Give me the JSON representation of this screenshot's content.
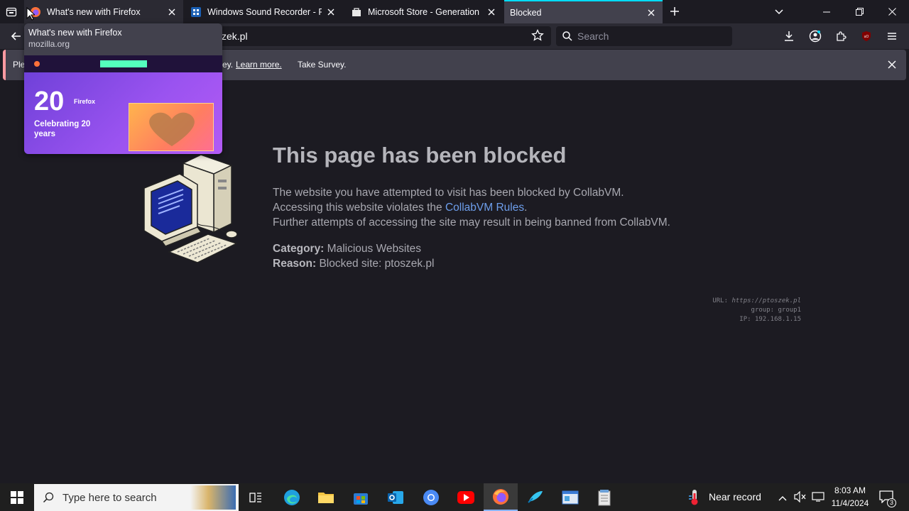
{
  "tabs": [
    {
      "title": "What's new with Firefox",
      "state": "hover"
    },
    {
      "title": "Windows Sound Recorder - Free",
      "state": "normal"
    },
    {
      "title": "Microsoft Store - Generation Pr",
      "state": "normal"
    },
    {
      "title": "Blocked",
      "state": "active"
    }
  ],
  "urlbar": {
    "url_partial": "zek.pl"
  },
  "searchbar": {
    "placeholder": "Search"
  },
  "notification": {
    "prefix": "Ple",
    "suffix": "ey.",
    "learn_more": "Learn more.",
    "take_survey": "Take Survey."
  },
  "tab_preview": {
    "title": "What's new with Firefox",
    "domain": "mozilla.org",
    "thumb_heading": "Celebrating 20 years",
    "thumb_brand": "Firefox",
    "thumb_big": "20"
  },
  "page": {
    "title": "This page has been blocked",
    "line1": "The website you have attempted to visit has been blocked by CollabVM.",
    "line2_pre": "Accessing this website violates the ",
    "line2_link": "CollabVM Rules",
    "line2_post": ".",
    "line3": "Further attempts of accessing the site may result in being banned from CollabVM.",
    "category_label": "Category:",
    "category_value": "Malicious Websites",
    "reason_label": "Reason:",
    "reason_value": "Blocked site: ptoszek.pl",
    "meta_url_label": "URL:",
    "meta_url": "https://ptoszek.pl",
    "meta_group": "group: group1",
    "meta_ip": "IP: 192.168.1.15"
  },
  "taskbar": {
    "search_placeholder": "Type here to search",
    "weather": "Near record",
    "time": "8:03 AM",
    "date": "11/4/2024",
    "notif_count": "3"
  },
  "colors": {
    "accent": "#00ddff",
    "link": "#6d9eeb",
    "background": "#1c1b22"
  }
}
